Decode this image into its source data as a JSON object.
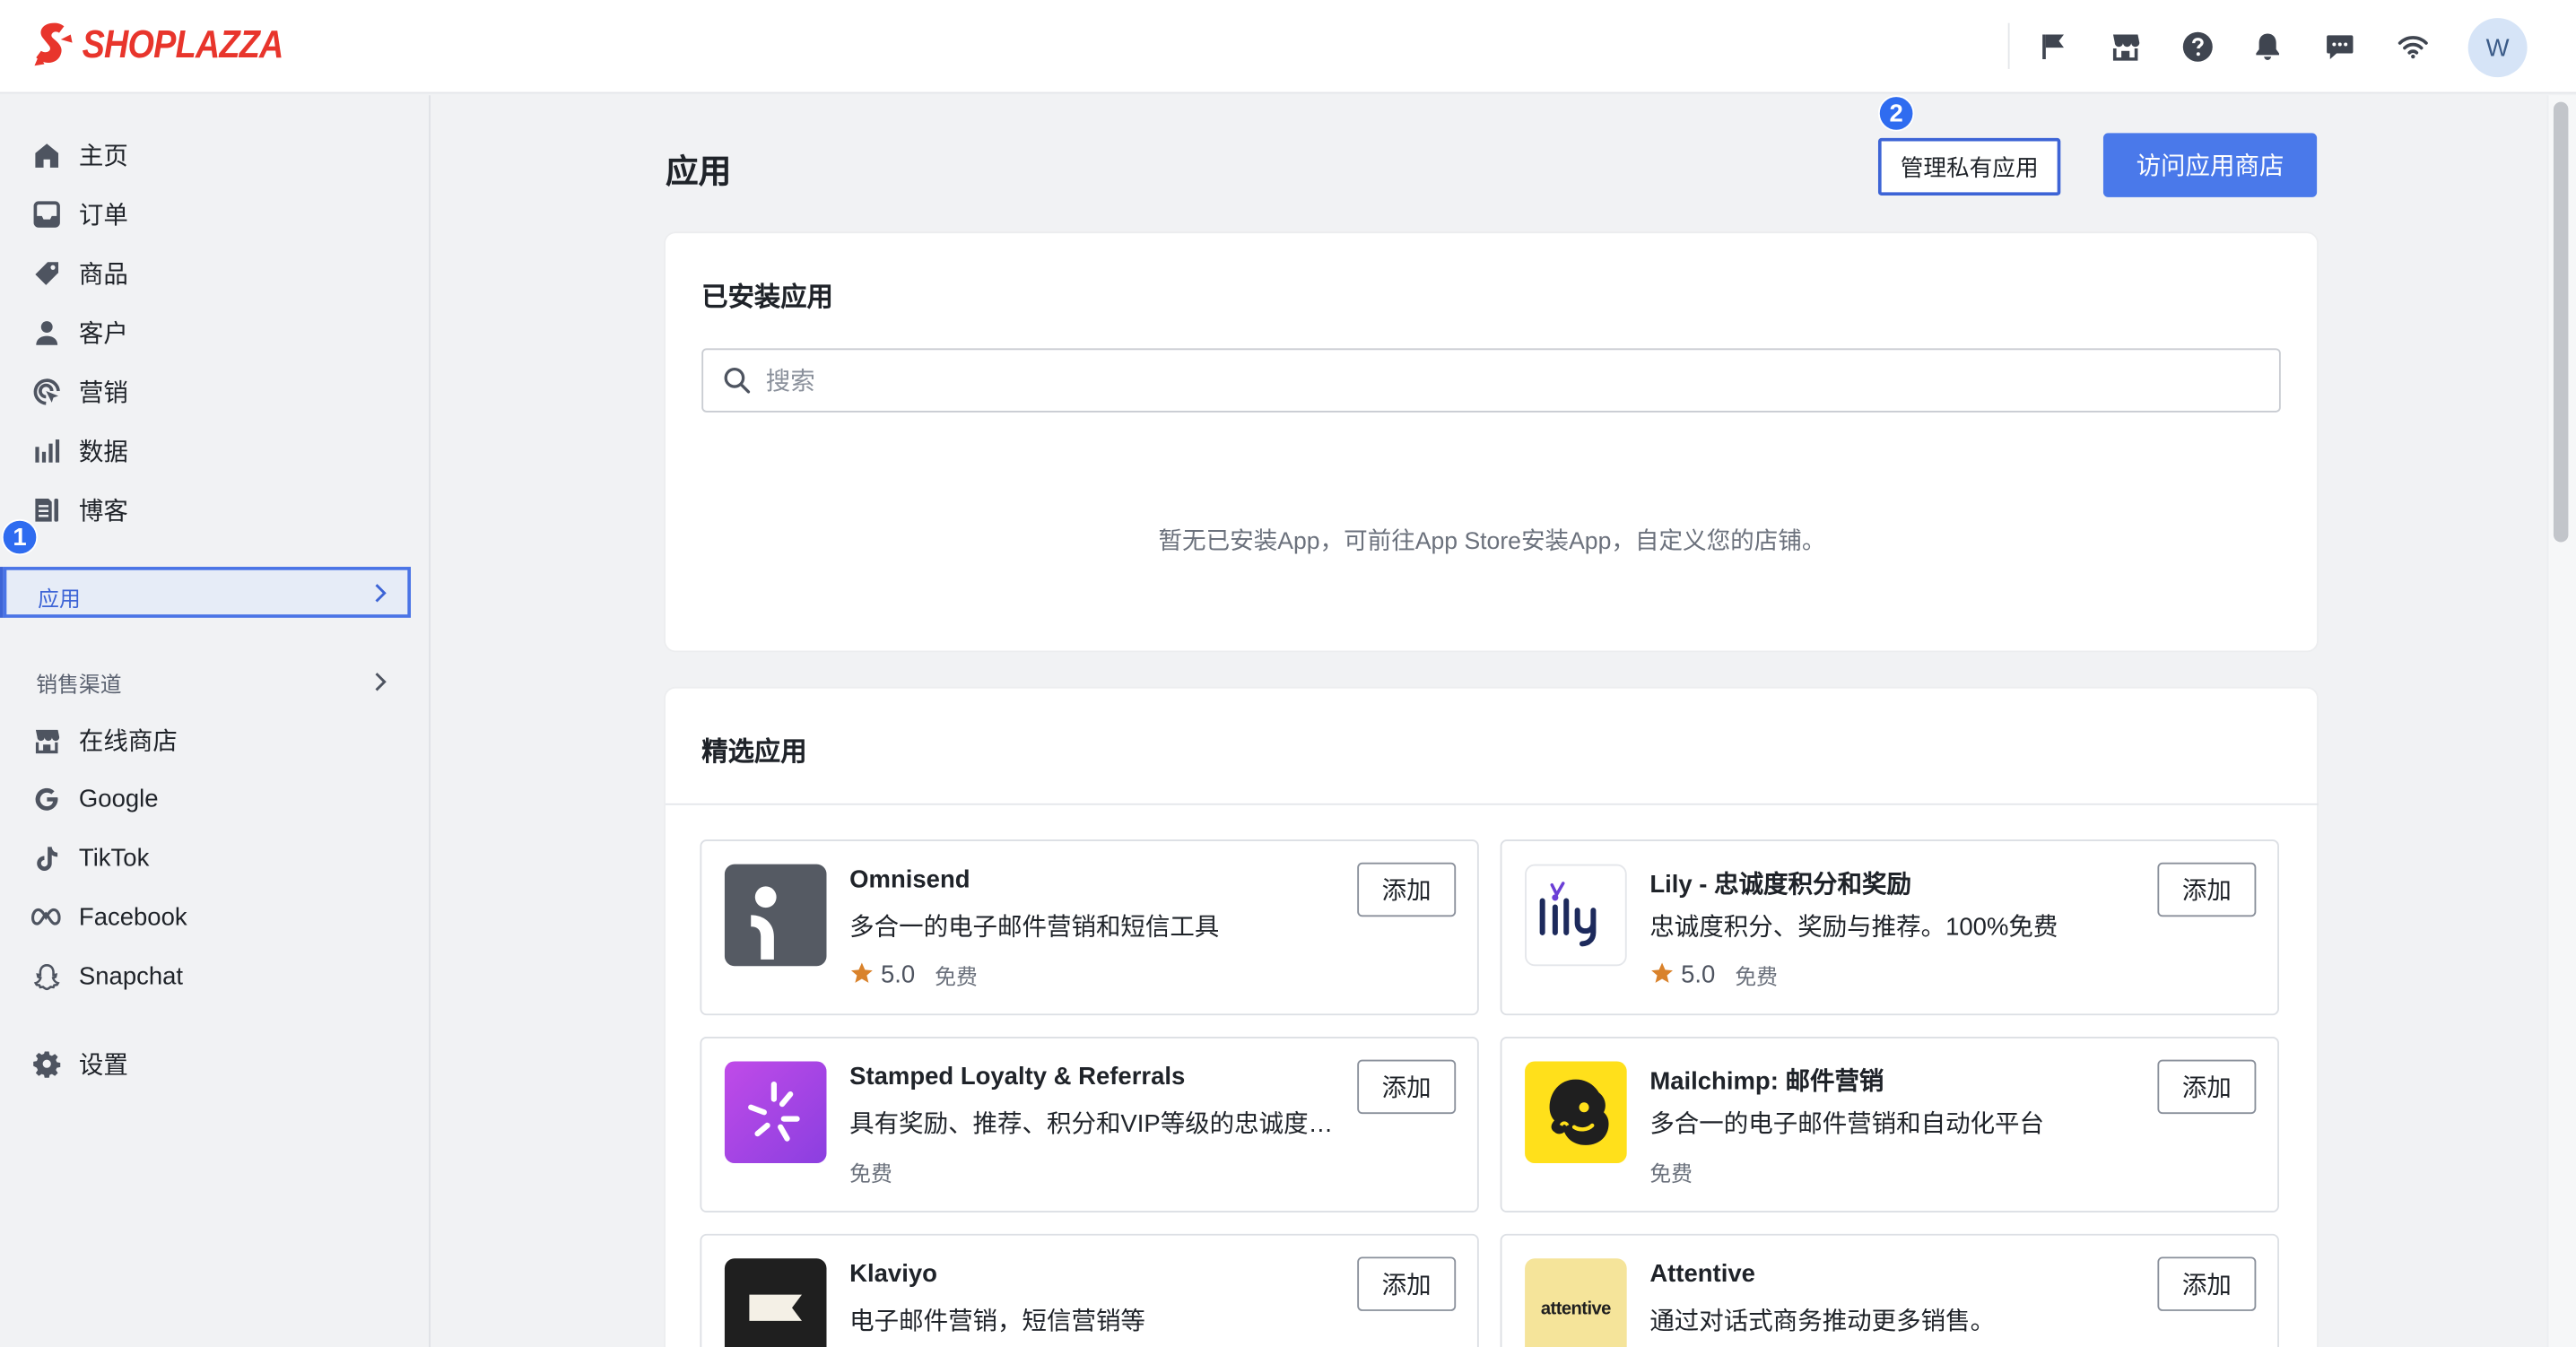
{
  "brand": {
    "name": "SHOPLAZZA",
    "color": "#e8352c"
  },
  "topbar": {
    "icons": [
      "flag-icon",
      "store-icon",
      "help-icon",
      "bell-icon",
      "chat-icon",
      "wifi-icon"
    ],
    "avatar_initial": "W"
  },
  "sidebar": {
    "items": [
      {
        "label": "主页",
        "icon": "home-icon"
      },
      {
        "label": "订单",
        "icon": "inbox-icon"
      },
      {
        "label": "商品",
        "icon": "tag-icon"
      },
      {
        "label": "客户",
        "icon": "person-icon"
      },
      {
        "label": "营销",
        "icon": "marketing-icon"
      },
      {
        "label": "数据",
        "icon": "bar-chart-icon"
      },
      {
        "label": "博客",
        "icon": "blog-icon"
      }
    ],
    "active_item": {
      "label": "应用",
      "marker": "1"
    },
    "channels_label": "销售渠道",
    "channels": [
      {
        "label": "在线商店",
        "icon": "store-icon"
      },
      {
        "label": "Google",
        "icon": "google-icon"
      },
      {
        "label": "TikTok",
        "icon": "tiktok-icon"
      },
      {
        "label": "Facebook",
        "icon": "meta-icon"
      },
      {
        "label": "Snapchat",
        "icon": "snapchat-icon"
      }
    ],
    "settings_label": "设置"
  },
  "main": {
    "title": "应用",
    "manage_private_button": "管理私有应用",
    "manage_marker": "2",
    "visit_store_button": "访问应用商店",
    "installed": {
      "title": "已安装应用",
      "search_placeholder": "搜索",
      "empty_message": "暂无已安装App，可前往App Store安装App，自定义您的店铺。"
    },
    "featured": {
      "title": "精选应用",
      "add_label": "添加",
      "apps": [
        {
          "name": "Omnisend",
          "desc": "多合一的电子邮件营销和短信工具",
          "rating": "5.0",
          "price": "免费",
          "icon": "omnisend-logo-icon"
        },
        {
          "name": "Lily - 忠诚度积分和奖励",
          "desc": "忠诚度积分、奖励与推荐。100%免费",
          "rating": "5.0",
          "price": "免费",
          "icon": "lily-logo-icon"
        },
        {
          "name": "Stamped Loyalty & Referrals",
          "desc": "具有奖励、推荐、积分和VIP等级的忠诚度计划",
          "rating": "",
          "price": "免费",
          "icon": "stamped-logo-icon"
        },
        {
          "name": "Mailchimp: 邮件营销",
          "desc": "多合一的电子邮件营销和自动化平台",
          "rating": "",
          "price": "免费",
          "icon": "mailchimp-logo-icon"
        },
        {
          "name": "Klaviyo",
          "desc": "电子邮件营销，短信营销等",
          "rating": "",
          "price": "",
          "icon": "klaviyo-logo-icon"
        },
        {
          "name": "Attentive",
          "desc": "通过对话式商务推动更多销售。",
          "rating": "",
          "price": "",
          "icon": "attentive-logo-icon",
          "logo_text": "attentive"
        }
      ]
    }
  },
  "colors": {
    "accent": "#4a79ea",
    "marker": "#2f6cf0",
    "star": "#d9822b"
  }
}
